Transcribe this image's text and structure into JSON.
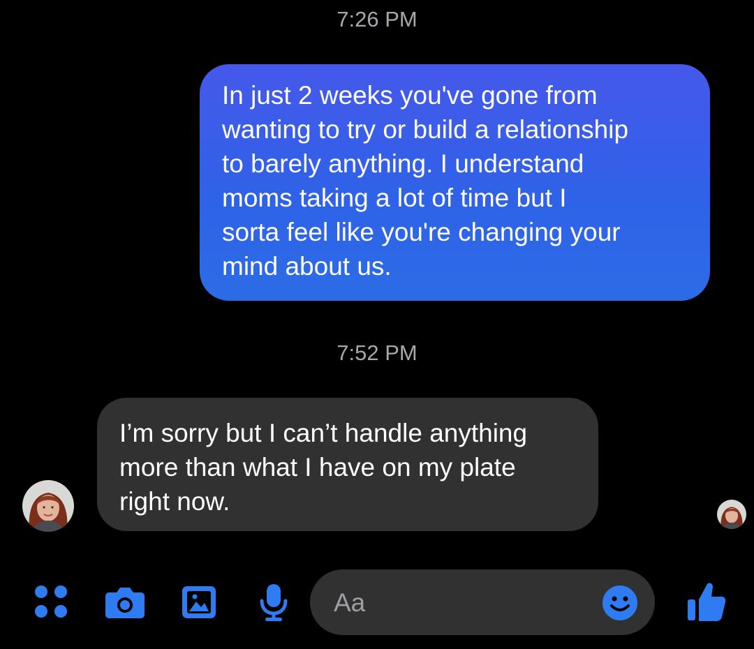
{
  "conversation": {
    "messages": [
      {
        "timestamp": "7:26 PM",
        "direction": "outgoing",
        "text": "In just 2 weeks you've gone from\nwanting to try or build a relationship\nto barely anything. I understand\nmoms taking a lot of time but I\nsorta feel like you're changing your\nmind about us."
      },
      {
        "timestamp": "7:52 PM",
        "direction": "incoming",
        "text": "I’m sorry but I can’t handle anything\nmore than what I have on my plate\nright now."
      }
    ]
  },
  "composer": {
    "placeholder": "Aa",
    "icons": [
      "apps-grid-icon",
      "camera-icon",
      "gallery-icon",
      "microphone-icon",
      "emoji-icon",
      "thumbs-up-icon"
    ]
  },
  "colors": {
    "background": "#000000",
    "accent": "#2f7bf2",
    "outgoing_bubble_top": "#4658eb",
    "outgoing_bubble_bottom": "#2b6ce6",
    "incoming_bubble": "#313131",
    "timestamp_text": "#a7a7ad",
    "placeholder_text": "#9e9ea4"
  }
}
